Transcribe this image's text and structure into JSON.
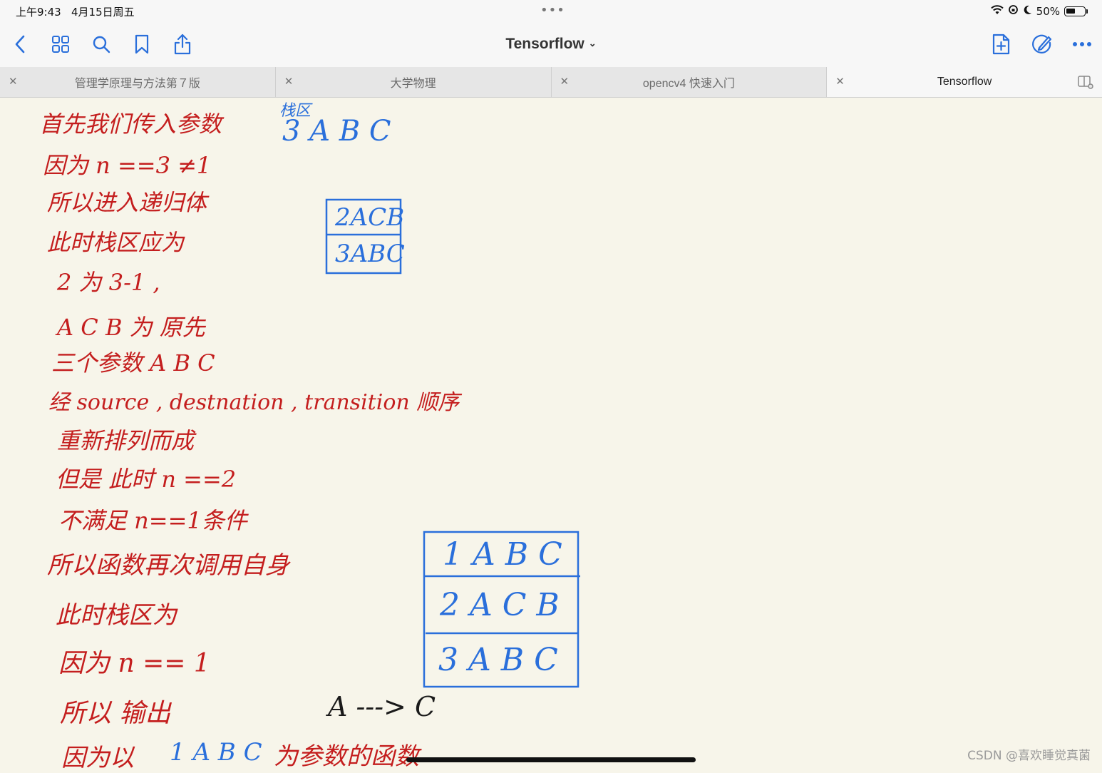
{
  "status_bar": {
    "time": "上午9:43",
    "date": "4月15日周五",
    "battery_text": "50%",
    "battery_level": 0.5
  },
  "toolbar": {
    "title": "Tensorflow",
    "icons": [
      "back-chevron-icon",
      "grid-icon",
      "search-icon",
      "bookmark-icon",
      "share-icon",
      "new-page-icon",
      "pencil-circle-icon",
      "more-icon"
    ]
  },
  "tabs": [
    {
      "label": "管理学原理与方法第７版",
      "active": false
    },
    {
      "label": "大学物理",
      "active": false
    },
    {
      "label": "opencv4 快速入门",
      "active": false
    },
    {
      "label": "Tensorflow",
      "active": true
    }
  ],
  "notes": {
    "lines": [
      "首先我们传入参数",
      "因为 n ==3 ≠1",
      "所以进入递归体",
      "此时栈区应为",
      "2 为 3-1 ,",
      "A C B 为 原先",
      "三个参数 A B C",
      "经 source , destnation , transition 顺序",
      "重新排列而成",
      "但是 此时 n ==2",
      "不满足 n==1条件",
      "所以函数再次调用自身",
      "此时栈区为",
      "因为 n == 1",
      "所以 输出",
      "因为以",
      "1 A B C",
      "为参数的函数"
    ],
    "stack_label": "栈区",
    "stack_top_value": "3 A B C",
    "stack2": [
      "2ACB",
      "3ABC"
    ],
    "stack3": [
      "1 A B C",
      "2 A C B",
      "3 A B C"
    ],
    "output": "A ---> C"
  },
  "watermark": "CSDN @喜欢睡觉真菌",
  "colors": {
    "red_ink": "#c41e1e",
    "blue_ink": "#2a6fdb",
    "paper": "#f7f5ea",
    "accent": "#2a6fdb"
  }
}
